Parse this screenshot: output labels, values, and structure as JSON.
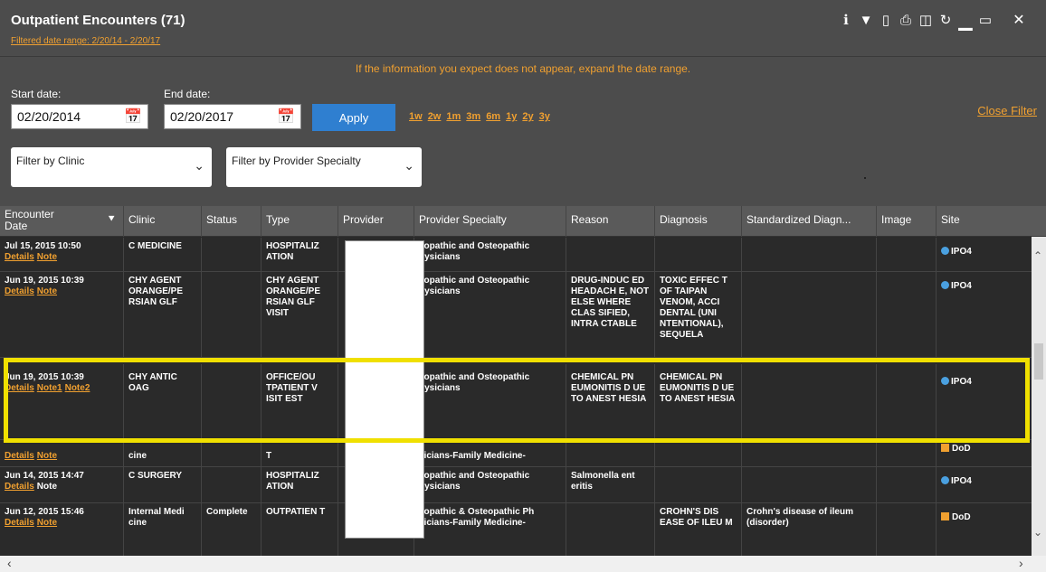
{
  "header": {
    "title": "Outpatient Encounters (71)",
    "subtitle": "Filtered date range: 2/20/14 - 2/20/17",
    "icons": [
      "info-icon",
      "filter-icon",
      "clipboard-icon",
      "print-icon",
      "columns-icon",
      "refresh-icon",
      "minimize-icon",
      "maximize-icon",
      "close-icon"
    ]
  },
  "filter": {
    "hint": "If the information you expect does not appear, expand the date range.",
    "start_label": "Start date:",
    "start_value": "02/20/2014",
    "end_label": "End date:",
    "end_value": "02/20/2017",
    "apply_label": "Apply",
    "quick_ranges": [
      "1w",
      "2w",
      "1m",
      "3m",
      "6m",
      "1y",
      "2y",
      "3y"
    ],
    "close_filter": "Close Filter",
    "clinic_filter": "Filter by Clinic",
    "specialty_filter": "Filter by Provider Specialty"
  },
  "columns": [
    "Encounter Date",
    "Clinic",
    "Status",
    "Type",
    "Provider",
    "Provider Specialty",
    "Reason",
    "Diagnosis",
    "Standardized Diagn...",
    "Image",
    "Site"
  ],
  "rows": [
    {
      "date": "Jul 15, 2015 10:50",
      "links": [
        "Details",
        "Note"
      ],
      "clinic": "C MEDICINE",
      "status": "",
      "type": "HOSPITALIZ ATION",
      "specialty": "llopathic and Osteopathic hysicians",
      "reason": "",
      "diagnosis": "",
      "standardized": "",
      "site": "IPO4",
      "site_kind": "va"
    },
    {
      "date": "Jun 19, 2015 10:39",
      "links": [
        "Details",
        "Note"
      ],
      "clinic": "CHY AGENT ORANGE/PE RSIAN GLF",
      "status": "",
      "type": "CHY AGENT ORANGE/PE RSIAN GLF VISIT",
      "specialty": "llopathic and Osteopathic hysicians",
      "reason": "DRUG-INDUC ED HEADACH E, NOT ELSE WHERE CLAS SIFIED, INTRA CTABLE",
      "diagnosis": "TOXIC EFFEC T OF TAIPAN VENOM, ACCI DENTAL (UNI NTENTIONAL), SEQUELA",
      "standardized": "",
      "site": "IPO4",
      "site_kind": "va"
    },
    {
      "date": "Jun 19, 2015 10:39",
      "links": [
        "Details",
        "Note1",
        "Note2"
      ],
      "clinic": "CHY ANTIC OAG",
      "status": "",
      "type": "OFFICE/OU TPATIENT V ISIT EST",
      "specialty": "llopathic and Osteopathic hysicians",
      "reason": "CHEMICAL PN EUMONITIS D UE TO ANEST HESIA",
      "diagnosis": "CHEMICAL PN EUMONITIS D UE TO ANEST HESIA",
      "standardized": "",
      "site": "IPO4",
      "site_kind": "va"
    },
    {
      "date": "",
      "links": [
        "Details",
        "Note"
      ],
      "clinic": "cine",
      "status": "",
      "type": "T",
      "specialty": "sicians-Family Medicine-",
      "reason": "",
      "diagnosis": "",
      "standardized": "",
      "site": "DoD",
      "site_kind": "dod"
    },
    {
      "date": "Jun 14, 2015 14:47",
      "links": [
        "Details",
        "Note"
      ],
      "clinic": "C SURGERY",
      "status": "",
      "type": "HOSPITALIZ ATION",
      "specialty": "llopathic and Osteopathic hysicians",
      "reason": "Salmonella ent eritis",
      "diagnosis": "",
      "standardized": "",
      "site": "IPO4",
      "site_kind": "va"
    },
    {
      "date": "Jun 12, 2015 15:46",
      "links": [
        "Details",
        "Note"
      ],
      "clinic": "Internal Medi cine",
      "status": "Complete",
      "type": "OUTPATIEN T",
      "specialty": "llopathic & Osteopathic Ph sicians-Family Medicine-",
      "reason": "",
      "diagnosis": "CROHN'S DIS EASE OF ILEU M",
      "standardized": "Crohn's disease of ileum (disorder)",
      "site": "DoD",
      "site_kind": "dod"
    }
  ]
}
